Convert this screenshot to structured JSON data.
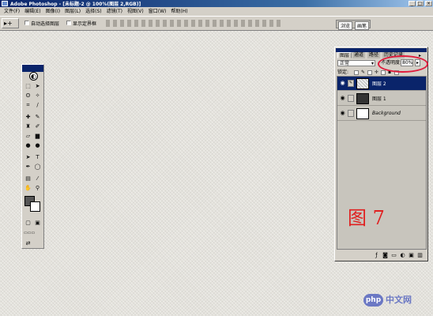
{
  "window": {
    "title": "Adobe Photoshop - [未标题-2 @ 100%(图层 2,RGB)]"
  },
  "menu": [
    "文件(F)",
    "编辑(E)",
    "图像(I)",
    "图层(L)",
    "选择(S)",
    "滤镜(T)",
    "视图(V)",
    "窗口(W)",
    "帮助(H)"
  ],
  "options": {
    "auto_select": "自动选择图层",
    "show_bounds": "显示定界框"
  },
  "palette_well_tabs": [
    "浏览",
    "画笔"
  ],
  "layers_panel": {
    "tabs": [
      "图层",
      "通道",
      "路径",
      "历史记录"
    ],
    "blend_mode": "正常",
    "opacity_label": "不透明度:",
    "opacity_value": "80%",
    "lock_label": "锁定:",
    "layers": [
      {
        "name": "图层 2",
        "selected": true,
        "thumb": "#e8e8e8"
      },
      {
        "name": "图层 1",
        "selected": false,
        "thumb": "#333333"
      },
      {
        "name": "Background",
        "selected": false,
        "thumb": "#ffffff"
      }
    ]
  },
  "caption": "图 7",
  "watermark": {
    "logo": "php",
    "text": "中文网"
  },
  "colors": {
    "title_bar": "#0a246a",
    "highlight": "#e01b3c",
    "caption": "#e02020"
  }
}
